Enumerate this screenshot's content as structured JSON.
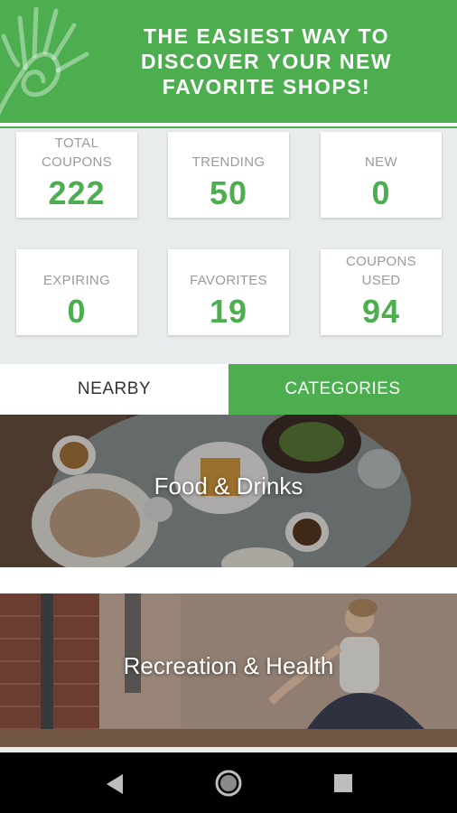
{
  "header": {
    "title_line1": "THE EASIEST WAY TO",
    "title_line2": "DISCOVER YOUR NEW",
    "title_line3": "FAVORITE SHOPS!",
    "bg_color": "#4cae4f",
    "logo_icon": "hand-spiral-icon"
  },
  "stats": [
    {
      "label_line1": "TOTAL",
      "label_line2": "COUPONS",
      "value": "222"
    },
    {
      "label_line1": "",
      "label_line2": "TRENDING",
      "value": "50"
    },
    {
      "label_line1": "",
      "label_line2": "NEW",
      "value": "0"
    },
    {
      "label_line1": "",
      "label_line2": "EXPIRING",
      "value": "0"
    },
    {
      "label_line1": "",
      "label_line2": "FAVORITES",
      "value": "19"
    },
    {
      "label_line1": "COUPONS",
      "label_line2": "USED",
      "value": "94"
    }
  ],
  "tabs": {
    "nearby": "NEARBY",
    "categories": "CATEGORIES",
    "active": "categories"
  },
  "categories": [
    {
      "label": "Food & Drinks",
      "image": "food-photo"
    },
    {
      "label": "Recreation & Health",
      "image": "yoga-photo"
    }
  ],
  "navbar": {
    "back_icon": "back-triangle-icon",
    "home_icon": "home-circle-icon",
    "recents_icon": "recents-square-icon"
  },
  "colors": {
    "accent": "#4cae4f",
    "stat_label": "#9a9a9a",
    "background": "#e9ecec"
  }
}
